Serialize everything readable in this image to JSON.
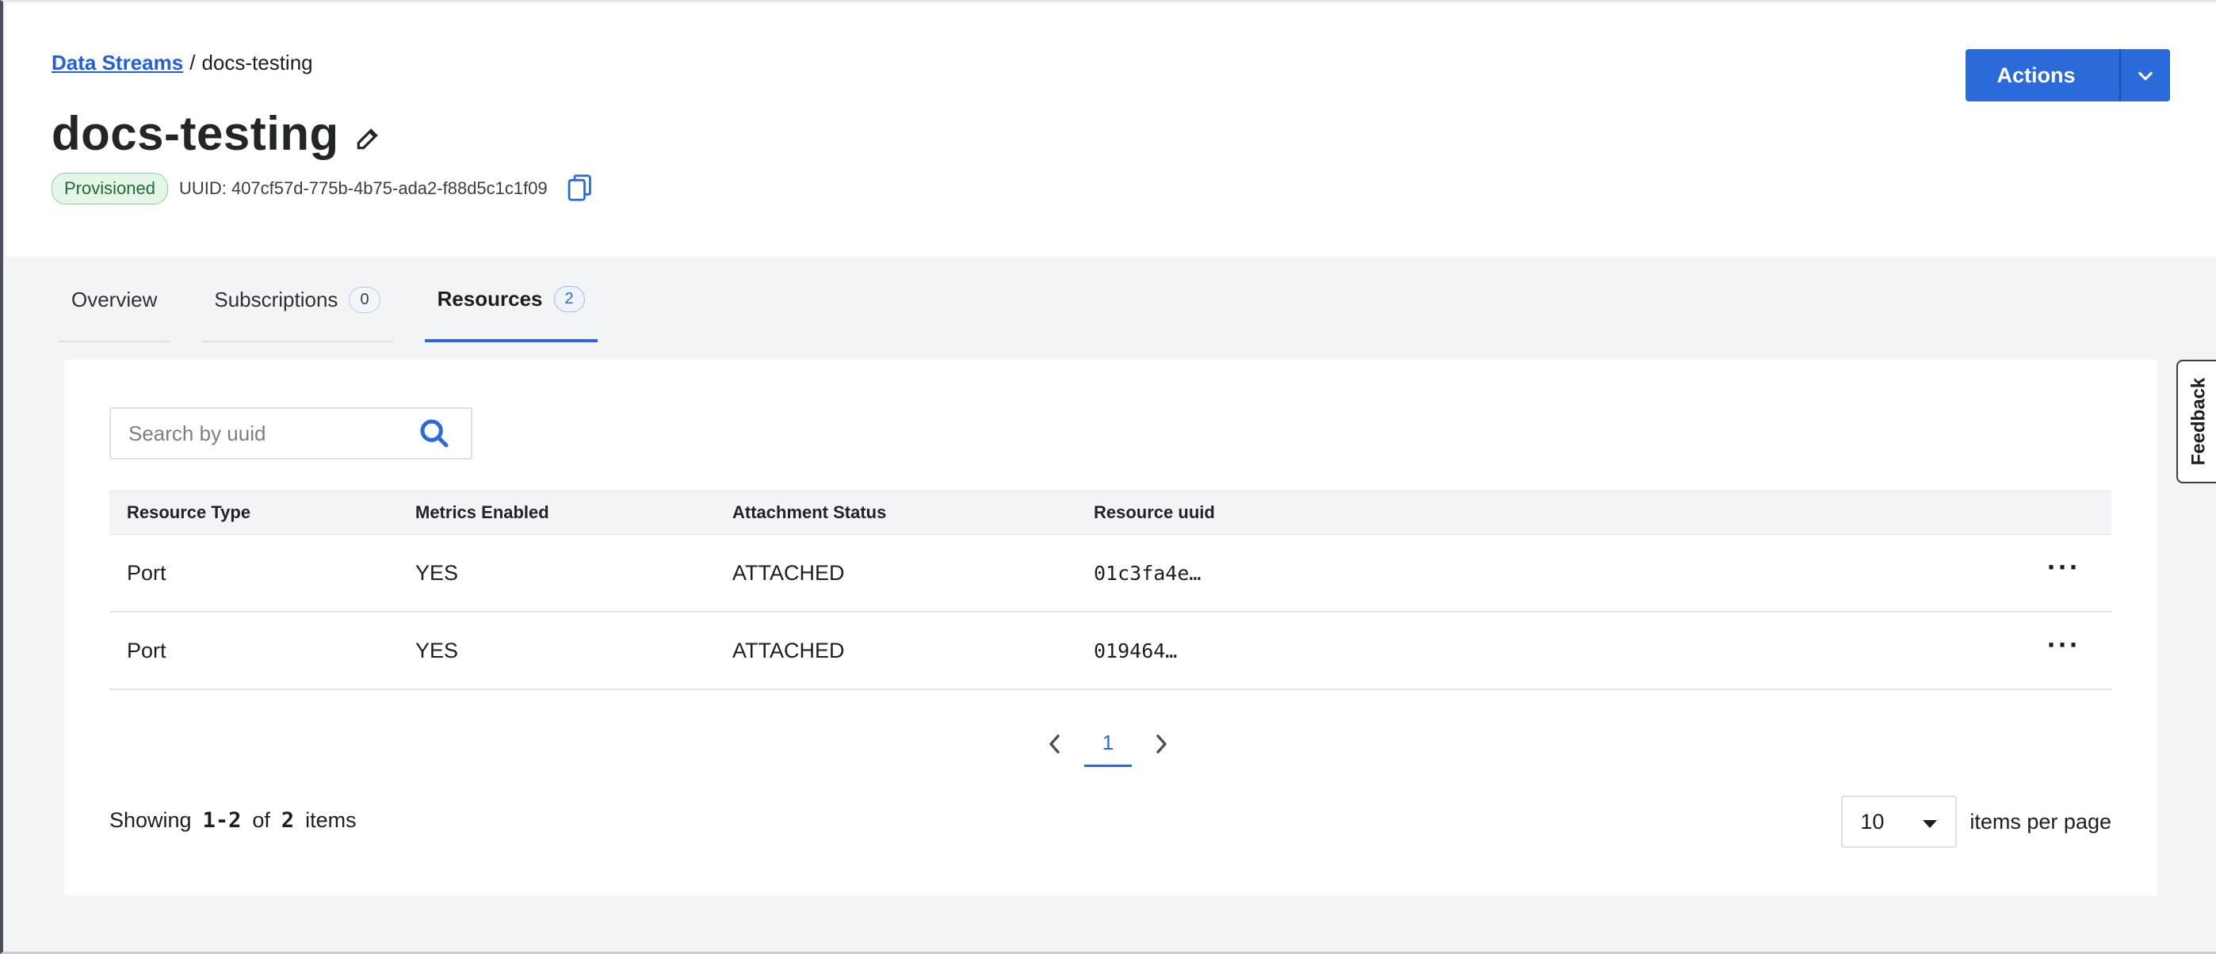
{
  "breadcrumb": {
    "parent": "Data Streams",
    "separator": "/",
    "current": "docs-testing"
  },
  "page": {
    "title": "docs-testing",
    "status": "Provisioned",
    "uuid_label": "UUID: 407cf57d-775b-4b75-ada2-f88d5c1c1f09"
  },
  "actions": {
    "label": "Actions"
  },
  "tabs": [
    {
      "label": "Overview",
      "count": null,
      "active": false
    },
    {
      "label": "Subscriptions",
      "count": "0",
      "active": false
    },
    {
      "label": "Resources",
      "count": "2",
      "active": true
    }
  ],
  "search": {
    "placeholder": "Search by uuid",
    "value": ""
  },
  "table": {
    "headers": [
      "Resource Type",
      "Metrics Enabled",
      "Attachment Status",
      "Resource uuid"
    ],
    "rows": [
      {
        "type": "Port",
        "metrics": "YES",
        "status": "ATTACHED",
        "uuid": "01c3fa4e…",
        "more": "···"
      },
      {
        "type": "Port",
        "metrics": "YES",
        "status": "ATTACHED",
        "uuid": "019464…",
        "more": "···"
      }
    ]
  },
  "pagination": {
    "current_page": "1"
  },
  "summary": {
    "prefix": "Showing",
    "range": "1-2",
    "of": "of",
    "total": "2",
    "suffix": "items"
  },
  "per_page": {
    "value": "10",
    "label": "items per page"
  },
  "feedback": {
    "label": "Feedback"
  },
  "colors": {
    "accent": "#2a6ad9",
    "status_green": "#1d6b35",
    "background": "#f3f4f6"
  }
}
